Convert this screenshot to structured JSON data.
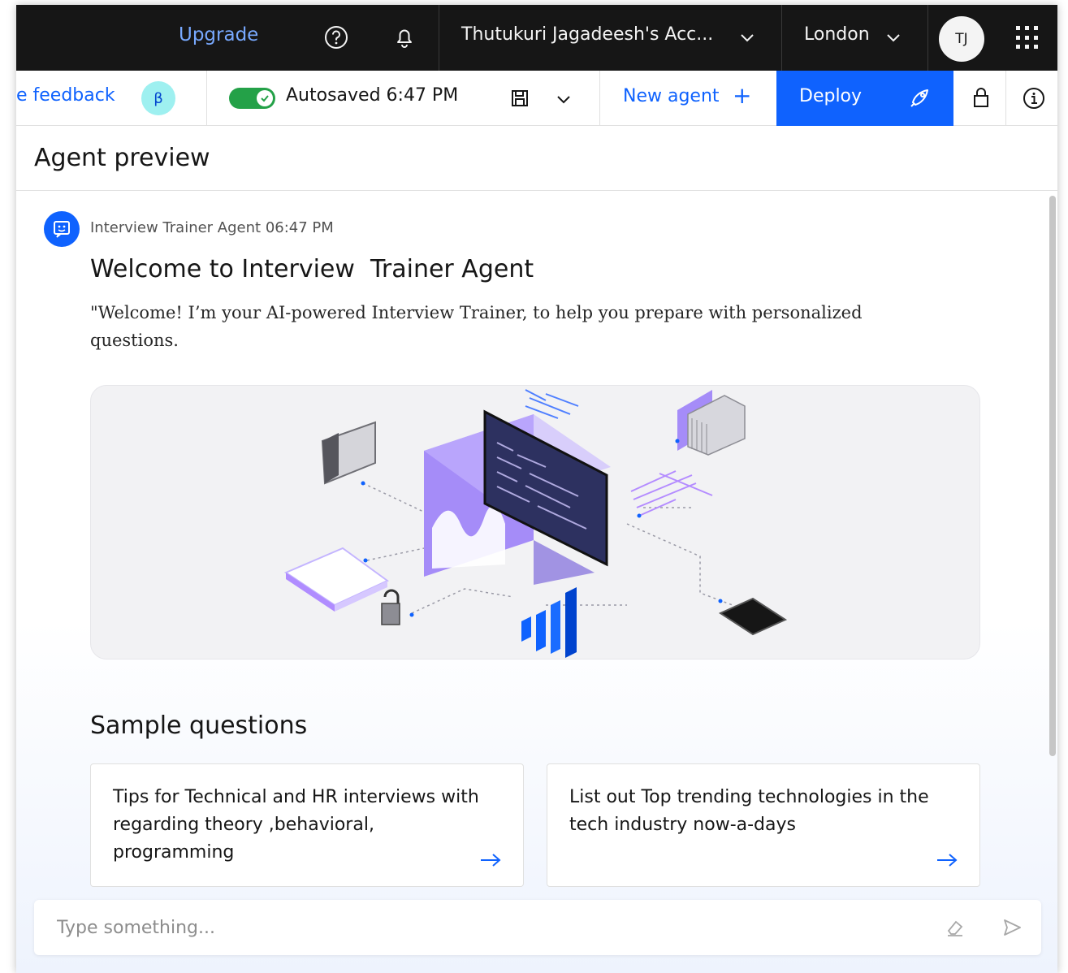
{
  "topbar": {
    "upgrade_label": "Upgrade",
    "account_name": "Thutukuri Jagadeesh's Acc...",
    "region": "London",
    "avatar_initials": "TJ"
  },
  "toolbar": {
    "feedback_label": "e feedback",
    "beta_badge": "β",
    "autosave_status": "Autosaved 6:47 PM",
    "new_agent_label": "New agent",
    "new_agent_plus": "+",
    "deploy_label": "Deploy"
  },
  "preview": {
    "title": "Agent preview"
  },
  "chat": {
    "sender": "Interview Trainer Agent",
    "time": "06:47 PM",
    "welcome_title": "Welcome to Interview  Trainer Agent",
    "message": "\"Welcome! I’m your AI-powered Interview Trainer, to help you prepare with personalized questions."
  },
  "sample_questions": {
    "heading": "Sample questions",
    "items": [
      {
        "text": "Tips for Technical and HR interviews with regarding theory ,behavioral, programming"
      },
      {
        "text": "List out Top trending technologies in the tech industry now-a-days"
      }
    ]
  },
  "input": {
    "placeholder": "Type something..."
  },
  "colors": {
    "brand_blue": "#0f62fe",
    "topbar_bg": "#161616",
    "toggle_on": "#24a148",
    "beta_bg": "#9ef0f0"
  }
}
